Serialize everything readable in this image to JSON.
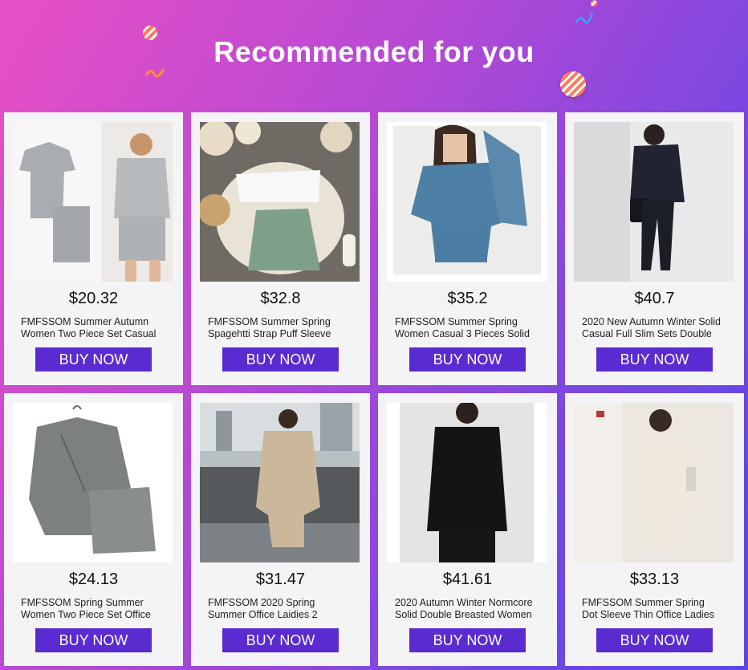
{
  "header": {
    "title": "Recommended for you"
  },
  "colors": {
    "button": "#5a2bd0",
    "gradient_start": "#e94fc6",
    "gradient_end": "#5a46e6"
  },
  "products": [
    {
      "price": "$20.32",
      "name_line1": "FMFSSOM Summer Autumn",
      "name_line2": "Women Two Piece Set Casual",
      "button": "BUY NOW",
      "image": "grey-top-shorts-set-photo"
    },
    {
      "price": "$32.8",
      "name_line1": "FMFSSOM Summer Spring",
      "name_line2": "Spagehtti Strap Puff Sleeve",
      "button": "BUY NOW",
      "image": "white-top-green-skirt-photo"
    },
    {
      "price": "$35.2",
      "name_line1": "FMFSSOM Summer Spring",
      "name_line2": "Women Casual 3 Pieces Solid",
      "button": "BUY NOW",
      "image": "blue-three-piece-set-photo"
    },
    {
      "price": "$40.7",
      "name_line1": "2020 New Autumn Winter Solid",
      "name_line2": "Casual Full Slim Sets Double",
      "button": "BUY NOW",
      "image": "black-blazer-suit-photo"
    },
    {
      "price": "$24.13",
      "name_line1": "FMFSSOM Spring Summer",
      "name_line2": "Women Two Piece Set Office",
      "button": "BUY NOW",
      "image": "plaid-blazer-shorts-photo"
    },
    {
      "price": "$31.47",
      "name_line1": "FMFSSOM 2020 Spring",
      "name_line2": "Summer Office Laidies 2",
      "button": "BUY NOW",
      "image": "beige-plaid-blazer-photo"
    },
    {
      "price": "$41.61",
      "name_line1": "2020 Autumn Winter Normcore",
      "name_line2": "Solid Double Breasted Women",
      "button": "BUY NOW",
      "image": "black-double-breasted-blazer-photo"
    },
    {
      "price": "$33.13",
      "name_line1": "FMFSSOM Summer Spring",
      "name_line2": "Dot Sleeve Thin Office Ladies",
      "button": "BUY NOW",
      "image": "cream-blazer-shorts-photo"
    }
  ]
}
